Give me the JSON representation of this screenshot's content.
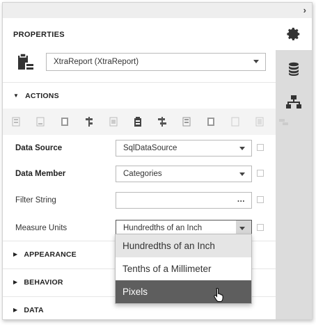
{
  "panel": {
    "title": "PROPERTIES",
    "report_selector": "XtraReport (XtraReport)"
  },
  "sidebar": {
    "tabs": [
      {
        "name": "properties",
        "icon": "gear-icon",
        "active": true
      },
      {
        "name": "field-list",
        "icon": "database-icon",
        "active": false
      },
      {
        "name": "report-explorer",
        "icon": "hierarchy-icon",
        "active": false
      }
    ]
  },
  "sections": {
    "actions": "ACTIONS",
    "appearance": "APPEARANCE",
    "behavior": "BEHAVIOR",
    "data": "DATA"
  },
  "actions_toolbar": {
    "icons": [
      "align-left-icon",
      "align-center-icon",
      "align-right-icon",
      "align-top-icon",
      "align-middle-icon",
      "align-bottom-icon",
      "size-width-icon",
      "size-height-icon",
      "size-both-icon",
      "spacing-icon",
      "center-icon",
      "send-back-icon"
    ]
  },
  "properties": {
    "data_source": {
      "label": "Data Source",
      "value": "SqlDataSource"
    },
    "data_member": {
      "label": "Data Member",
      "value": "Categories"
    },
    "filter_string": {
      "label": "Filter String",
      "value": "",
      "button": "..."
    },
    "measure_units": {
      "label": "Measure Units",
      "value": "Hundredths of an Inch"
    }
  },
  "measure_units_dropdown": {
    "options": [
      "Hundredths of an Inch",
      "Tenths of a Millimeter",
      "Pixels"
    ],
    "hovered": "Hundredths of an Inch",
    "selected": "Pixels"
  },
  "colors": {
    "selected_bg": "#5e5e5e",
    "sidebar_bg": "#dcdcdc",
    "topbar_bg": "#eeeeee"
  }
}
